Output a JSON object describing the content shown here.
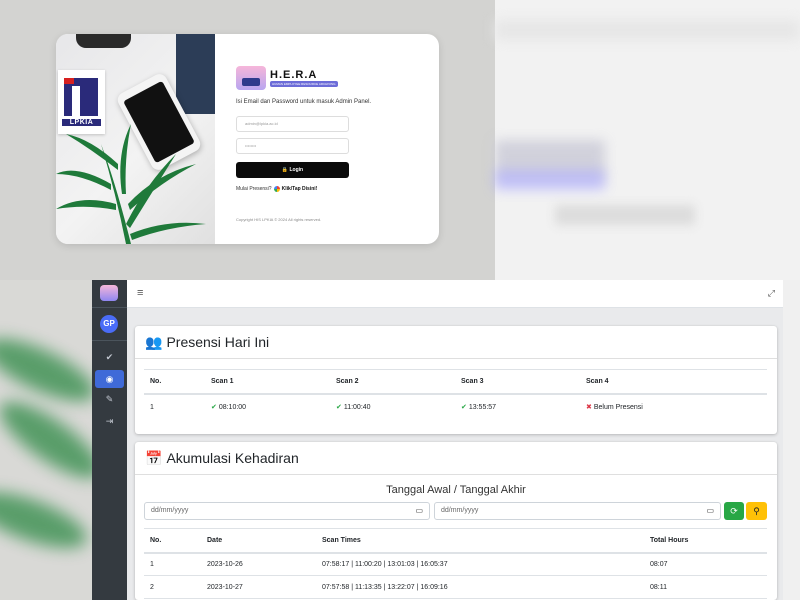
{
  "login": {
    "photo_logo_text": "LPKIA",
    "brand_title": "H.E.R.A",
    "brand_subtitle": "HUMAN EMPLOYEE RESOURCE ARCHIVING",
    "instruction": "Isi Email dan Password untuk masuk Admin Panel.",
    "email_placeholder": "admin@lpkia.ac.id",
    "password_placeholder": "••••••••",
    "login_button": "Login",
    "presensi_prefix": "Mulai Presensi?",
    "presensi_link": "Klik/Tap Disini!",
    "copyright": "Copyright HIS LPKIA © 2024 All rights reserved."
  },
  "sidebar": {
    "avatar_initials": "GP",
    "items": [
      {
        "icon": "check-circle-icon",
        "glyph": "✔"
      },
      {
        "icon": "eye-icon",
        "glyph": "◉",
        "active": true
      },
      {
        "icon": "user-check-icon",
        "glyph": "✎"
      },
      {
        "icon": "sign-out-icon",
        "glyph": "⇥"
      }
    ]
  },
  "topbar": {
    "menu_glyph": "≡",
    "expand_glyph": "⤢"
  },
  "presensi": {
    "title": "Presensi Hari Ini",
    "headers": [
      "No.",
      "Scan 1",
      "Scan 2",
      "Scan 3",
      "Scan 4"
    ],
    "row": {
      "no": "1",
      "scan1": "08:10:00",
      "scan2": "11:00:40",
      "scan3": "13:55:57",
      "scan4": "Belum Presensi"
    }
  },
  "akumulasi": {
    "title": "Akumulasi Kehadiran",
    "range_title": "Tanggal Awal / Tanggal Akhir",
    "date_start_placeholder": "dd/mm/yyyy",
    "date_end_placeholder": "dd/mm/yyyy",
    "headers": [
      "No.",
      "Date",
      "Scan Times",
      "Total Hours"
    ],
    "rows": [
      {
        "no": "1",
        "date": "2023-10-26",
        "scan_times": "07:58:17 | 11:00:20 | 13:01:03 | 16:05:37",
        "total": "08:07"
      },
      {
        "no": "2",
        "date": "2023-10-27",
        "scan_times": "07:57:58 | 11:13:35 | 13:22:07 | 16:09:16",
        "total": "08:11"
      }
    ]
  },
  "colors": {
    "accent": "#3f6ad8",
    "success": "#28a745",
    "danger": "#dc3545",
    "warning": "#ffc107",
    "sidebar": "#343a40"
  }
}
